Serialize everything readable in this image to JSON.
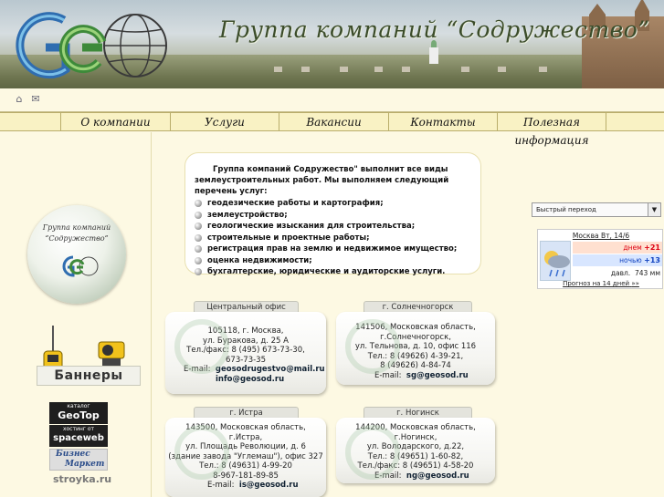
{
  "header": {
    "title": "Группа компаний “Содружество”"
  },
  "iconbar": {
    "home_icon": "home-icon",
    "mail_icon": "mail-icon"
  },
  "nav": {
    "items": [
      "О компании",
      "Услуги",
      "Вакансии",
      "Контакты",
      "Полезная информация"
    ]
  },
  "left": {
    "emblem_line1": "Группа компаний",
    "emblem_line2": "“Содружество”",
    "banners_title": "Баннеры",
    "banner_geotop_small": "каталог",
    "banner_geotop_big": "GeoTop",
    "banner_spaceweb_small": "хостинг от",
    "banner_spaceweb_big": "spaceweb",
    "banner_market_1": "Бизнес",
    "banner_market_2": "Маркет",
    "banner_stroyka": "stroyka.ru"
  },
  "intro": {
    "text": "Группа компаний  Содружество\" выполнит все виды землеустроительных работ. Мы выполняем следующий перечень услуг:",
    "services": [
      "геодезические работы и картография;",
      "землеустройство;",
      "геологические изыскания для строительства;",
      "строительные и проектные работы;",
      "регистрация прав на землю и недвижимое имущество;",
      "оценка недвижимости;",
      "бухгалтерские, юридические и аудиторские услуги."
    ]
  },
  "offices": [
    {
      "title": "Центральный офис",
      "lines": [
        "105118, г. Москва,",
        "ул. Буракова, д. 25 А",
        "Тел./факс: 8 (495) 673-73-30,",
        "673-73-35"
      ],
      "email_label": "E-mail:",
      "emails": [
        "geosodrugestvo@mail.ru",
        "info@geosod.ru"
      ]
    },
    {
      "title": "г. Солнечногорск",
      "lines": [
        "141506, Московская область,",
        "г.Солнечногорск,",
        "ул. Тельнова, д. 10, офис 116",
        "Тел.: 8 (49626) 4-39-21,",
        "8 (49626) 4-84-74"
      ],
      "email_label": "E-mail:",
      "emails": [
        "sg@geosod.ru"
      ]
    },
    {
      "title": "г. Истра",
      "lines": [
        "143500, Московская область,",
        "г.Истра,",
        "ул. Площадь Революции, д. 6",
        "(здание завода \"Углемаш\"), офис 327",
        "Тел.: 8 (49631) 4-99-20",
        "8-967-181-89-85"
      ],
      "email_label": "E-mail:",
      "emails": [
        "is@geosod.ru"
      ]
    },
    {
      "title": "г. Ногинск",
      "lines": [
        "144200, Московская область,",
        "г.Ногинск,",
        "ул. Володарского, д.22,",
        "Тел.: 8 (49651) 1-60-82,",
        "Тел./факс: 8 (49651) 4-58-20"
      ],
      "email_label": "E-mail:",
      "emails": [
        "ng@geosod.ru"
      ]
    }
  ],
  "quick": {
    "label": "Быстрый переход"
  },
  "weather": {
    "city": "Москва  Вт, 14/6",
    "day_label": "днем",
    "day_temp": "+21",
    "night_label": "ночью",
    "night_temp": "+13",
    "press_label": "давл.",
    "press_value": "743 мм",
    "forecast": "Прогноз на 14 дней",
    "day_color": "#d01111",
    "night_color": "#1142c0"
  }
}
